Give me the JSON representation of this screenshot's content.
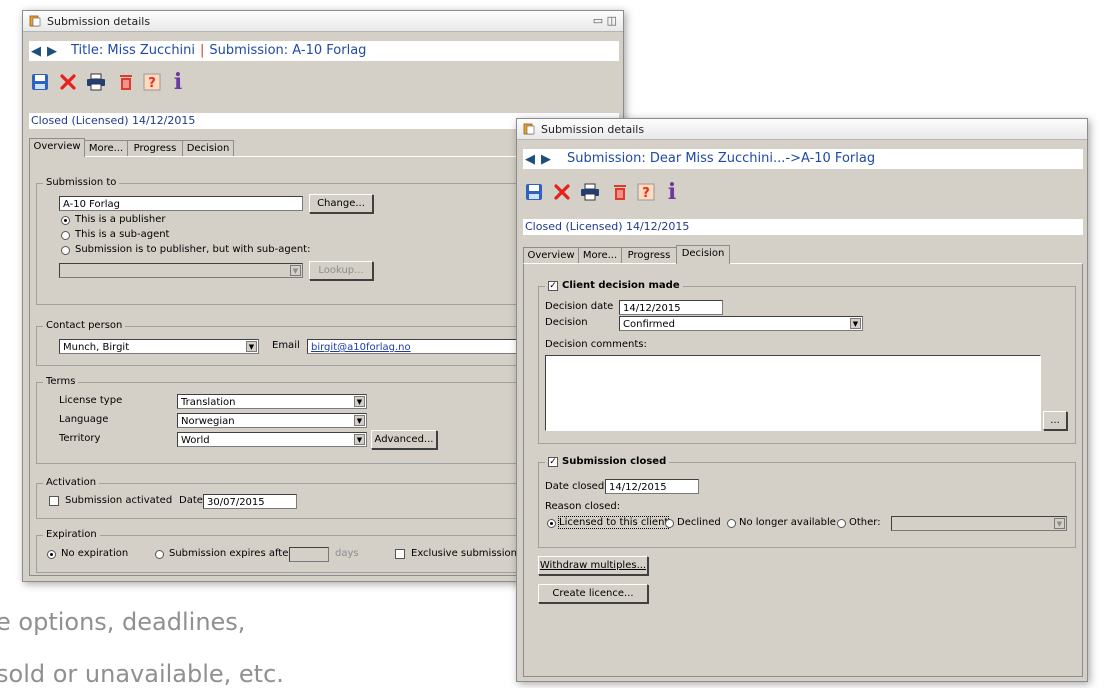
{
  "caption": {
    "line1": "e options, deadlines,",
    "line2": "sold or unavailable, etc."
  },
  "colors": {
    "accent": "#1e4aa8",
    "separator": "#d43a2a",
    "window_bg": "#d4d0c8"
  },
  "window1": {
    "title": "Submission details",
    "header": {
      "title_part": "Title: Miss Zucchini",
      "separator": "|",
      "submission_part": "Submission: A-10 Forlag"
    },
    "toolbar_icons": [
      "save-icon",
      "delete-icon",
      "print-icon",
      "trash-icon",
      "help-icon",
      "info-icon"
    ],
    "info_glyph": "i",
    "help_glyph": "?",
    "status": "Closed (Licensed) 14/12/2015",
    "tabs": [
      "Overview",
      "More...",
      "Progress",
      "Decision"
    ],
    "active_tab": "Overview",
    "submission_to": {
      "legend": "Submission to",
      "value": "A-10 Forlag",
      "change_button": "Change...",
      "options": [
        "This is a publisher",
        "This is a sub-agent",
        "Submission is to publisher, but with sub-agent:"
      ],
      "selected_option": 0,
      "lookup_button": "Lookup..."
    },
    "contact": {
      "legend": "Contact person",
      "person": "Munch, Birgit",
      "email_label": "Email",
      "email": "birgit@a10forlag.no"
    },
    "terms": {
      "legend": "Terms",
      "license_type_label": "License type",
      "license_type": "Translation",
      "language_label": "Language",
      "language": "Norwegian",
      "territory_label": "Territory",
      "territory": "World",
      "advanced_button": "Advanced..."
    },
    "activation": {
      "legend": "Activation",
      "checkbox_label": "Submission activated",
      "date_label": "Date",
      "date": "30/07/2015"
    },
    "expiration": {
      "legend": "Expiration",
      "no_expiration": "No expiration",
      "expires_after": "Submission expires after:",
      "days": "days",
      "exclusive": "Exclusive submission (\"op"
    }
  },
  "window2": {
    "title": "Submission details",
    "header": {
      "text": "Submission: Dear Miss Zucchini...->A-10 Forlag"
    },
    "status": "Closed (Licensed) 14/12/2015",
    "tabs": [
      "Overview",
      "More...",
      "Progress",
      "Decision"
    ],
    "active_tab": "Decision",
    "client_decision": {
      "legend": "Client decision made",
      "checked": true,
      "decision_date_label": "Decision date",
      "decision_date": "14/12/2015",
      "decision_label": "Decision",
      "decision": "Confirmed",
      "comments_label": "Decision comments:",
      "ellipsis_button": "..."
    },
    "submission_closed": {
      "legend": "Submission closed",
      "checked": true,
      "date_closed_label": "Date closed",
      "date_closed": "14/12/2015",
      "reason_label": "Reason closed:",
      "reasons": [
        "Licensed to this client",
        "Declined",
        "No longer available",
        "Other:"
      ],
      "selected_reason": 0
    },
    "withdraw_button": "Withdraw multiples...",
    "create_licence_button": "Create licence..."
  }
}
